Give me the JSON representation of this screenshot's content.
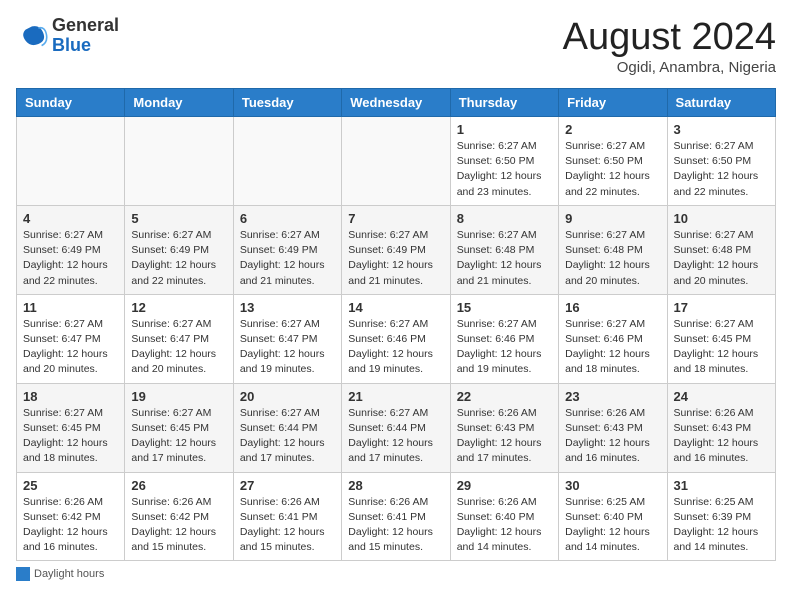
{
  "logo": {
    "general": "General",
    "blue": "Blue"
  },
  "header": {
    "month_year": "August 2024",
    "location": "Ogidi, Anambra, Nigeria"
  },
  "days_of_week": [
    "Sunday",
    "Monday",
    "Tuesday",
    "Wednesday",
    "Thursday",
    "Friday",
    "Saturday"
  ],
  "weeks": [
    [
      {
        "day": "",
        "info": ""
      },
      {
        "day": "",
        "info": ""
      },
      {
        "day": "",
        "info": ""
      },
      {
        "day": "",
        "info": ""
      },
      {
        "day": "1",
        "info": "Sunrise: 6:27 AM\nSunset: 6:50 PM\nDaylight: 12 hours and 23 minutes."
      },
      {
        "day": "2",
        "info": "Sunrise: 6:27 AM\nSunset: 6:50 PM\nDaylight: 12 hours and 22 minutes."
      },
      {
        "day": "3",
        "info": "Sunrise: 6:27 AM\nSunset: 6:50 PM\nDaylight: 12 hours and 22 minutes."
      }
    ],
    [
      {
        "day": "4",
        "info": "Sunrise: 6:27 AM\nSunset: 6:49 PM\nDaylight: 12 hours and 22 minutes."
      },
      {
        "day": "5",
        "info": "Sunrise: 6:27 AM\nSunset: 6:49 PM\nDaylight: 12 hours and 22 minutes."
      },
      {
        "day": "6",
        "info": "Sunrise: 6:27 AM\nSunset: 6:49 PM\nDaylight: 12 hours and 21 minutes."
      },
      {
        "day": "7",
        "info": "Sunrise: 6:27 AM\nSunset: 6:49 PM\nDaylight: 12 hours and 21 minutes."
      },
      {
        "day": "8",
        "info": "Sunrise: 6:27 AM\nSunset: 6:48 PM\nDaylight: 12 hours and 21 minutes."
      },
      {
        "day": "9",
        "info": "Sunrise: 6:27 AM\nSunset: 6:48 PM\nDaylight: 12 hours and 20 minutes."
      },
      {
        "day": "10",
        "info": "Sunrise: 6:27 AM\nSunset: 6:48 PM\nDaylight: 12 hours and 20 minutes."
      }
    ],
    [
      {
        "day": "11",
        "info": "Sunrise: 6:27 AM\nSunset: 6:47 PM\nDaylight: 12 hours and 20 minutes."
      },
      {
        "day": "12",
        "info": "Sunrise: 6:27 AM\nSunset: 6:47 PM\nDaylight: 12 hours and 20 minutes."
      },
      {
        "day": "13",
        "info": "Sunrise: 6:27 AM\nSunset: 6:47 PM\nDaylight: 12 hours and 19 minutes."
      },
      {
        "day": "14",
        "info": "Sunrise: 6:27 AM\nSunset: 6:46 PM\nDaylight: 12 hours and 19 minutes."
      },
      {
        "day": "15",
        "info": "Sunrise: 6:27 AM\nSunset: 6:46 PM\nDaylight: 12 hours and 19 minutes."
      },
      {
        "day": "16",
        "info": "Sunrise: 6:27 AM\nSunset: 6:46 PM\nDaylight: 12 hours and 18 minutes."
      },
      {
        "day": "17",
        "info": "Sunrise: 6:27 AM\nSunset: 6:45 PM\nDaylight: 12 hours and 18 minutes."
      }
    ],
    [
      {
        "day": "18",
        "info": "Sunrise: 6:27 AM\nSunset: 6:45 PM\nDaylight: 12 hours and 18 minutes."
      },
      {
        "day": "19",
        "info": "Sunrise: 6:27 AM\nSunset: 6:45 PM\nDaylight: 12 hours and 17 minutes."
      },
      {
        "day": "20",
        "info": "Sunrise: 6:27 AM\nSunset: 6:44 PM\nDaylight: 12 hours and 17 minutes."
      },
      {
        "day": "21",
        "info": "Sunrise: 6:27 AM\nSunset: 6:44 PM\nDaylight: 12 hours and 17 minutes."
      },
      {
        "day": "22",
        "info": "Sunrise: 6:26 AM\nSunset: 6:43 PM\nDaylight: 12 hours and 17 minutes."
      },
      {
        "day": "23",
        "info": "Sunrise: 6:26 AM\nSunset: 6:43 PM\nDaylight: 12 hours and 16 minutes."
      },
      {
        "day": "24",
        "info": "Sunrise: 6:26 AM\nSunset: 6:43 PM\nDaylight: 12 hours and 16 minutes."
      }
    ],
    [
      {
        "day": "25",
        "info": "Sunrise: 6:26 AM\nSunset: 6:42 PM\nDaylight: 12 hours and 16 minutes."
      },
      {
        "day": "26",
        "info": "Sunrise: 6:26 AM\nSunset: 6:42 PM\nDaylight: 12 hours and 15 minutes."
      },
      {
        "day": "27",
        "info": "Sunrise: 6:26 AM\nSunset: 6:41 PM\nDaylight: 12 hours and 15 minutes."
      },
      {
        "day": "28",
        "info": "Sunrise: 6:26 AM\nSunset: 6:41 PM\nDaylight: 12 hours and 15 minutes."
      },
      {
        "day": "29",
        "info": "Sunrise: 6:26 AM\nSunset: 6:40 PM\nDaylight: 12 hours and 14 minutes."
      },
      {
        "day": "30",
        "info": "Sunrise: 6:25 AM\nSunset: 6:40 PM\nDaylight: 12 hours and 14 minutes."
      },
      {
        "day": "31",
        "info": "Sunrise: 6:25 AM\nSunset: 6:39 PM\nDaylight: 12 hours and 14 minutes."
      }
    ]
  ],
  "legend": {
    "label": "Daylight hours"
  }
}
